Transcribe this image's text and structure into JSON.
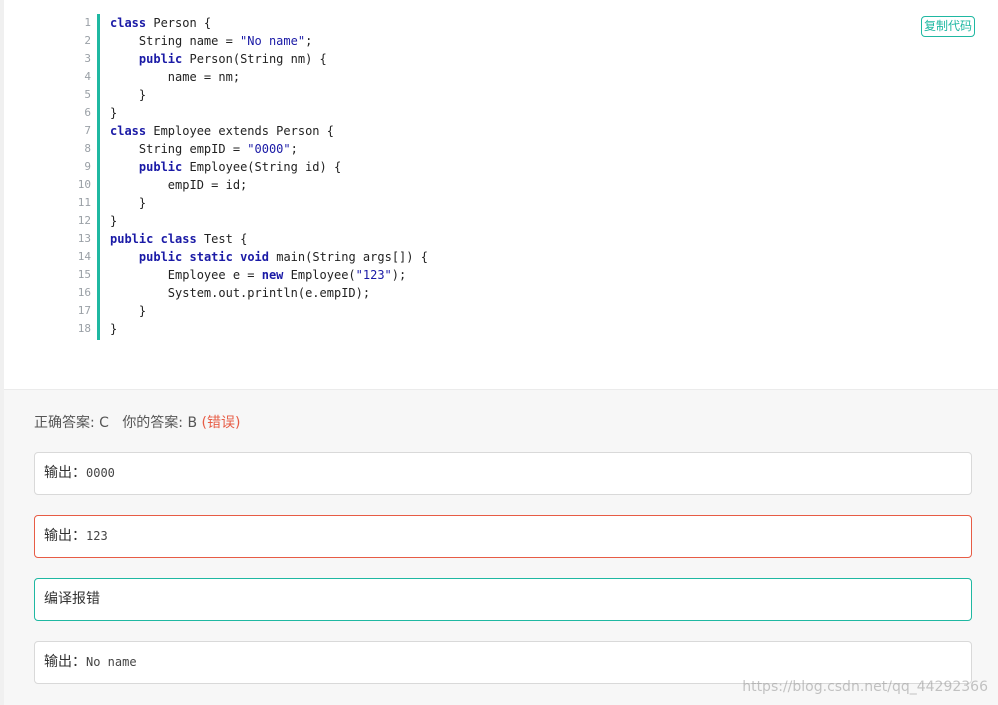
{
  "toolbar": {
    "copy_label": "复制代码"
  },
  "code": {
    "lines": [
      {
        "n": "1",
        "text": "class Person {"
      },
      {
        "n": "2",
        "text": "    String name = \"No name\";"
      },
      {
        "n": "3",
        "text": "    public Person(String nm) {"
      },
      {
        "n": "4",
        "text": "        name = nm;"
      },
      {
        "n": "5",
        "text": "    }"
      },
      {
        "n": "6",
        "text": "}"
      },
      {
        "n": "7",
        "text": "class Employee extends Person {"
      },
      {
        "n": "8",
        "text": "    String empID = \"0000\";"
      },
      {
        "n": "9",
        "text": "    public Employee(String id) {"
      },
      {
        "n": "10",
        "text": "        empID = id;"
      },
      {
        "n": "11",
        "text": "    }"
      },
      {
        "n": "12",
        "text": "}"
      },
      {
        "n": "13",
        "text": "public class Test {"
      },
      {
        "n": "14",
        "text": "    public static void main(String args[]) {"
      },
      {
        "n": "15",
        "text": "        Employee e = new Employee(\"123\");"
      },
      {
        "n": "16",
        "text": "        System.out.println(e.empID);"
      },
      {
        "n": "17",
        "text": "    }"
      },
      {
        "n": "18",
        "text": "}"
      }
    ]
  },
  "answer": {
    "correct_label": "正确答案: C",
    "yours_label": "你的答案: B",
    "status": "(错误)"
  },
  "options": [
    {
      "prefix": "输出：",
      "value": "0000",
      "state": "normal"
    },
    {
      "prefix": "输出：",
      "value": "123",
      "state": "wrong"
    },
    {
      "prefix": "编译报错",
      "value": "",
      "state": "correct"
    },
    {
      "prefix": "输出：",
      "value": "No name",
      "state": "normal"
    }
  ],
  "watermark": "https://blog.csdn.net/qq_44292366",
  "colors": {
    "accent": "#1fb8a2",
    "error": "#e75c45"
  }
}
